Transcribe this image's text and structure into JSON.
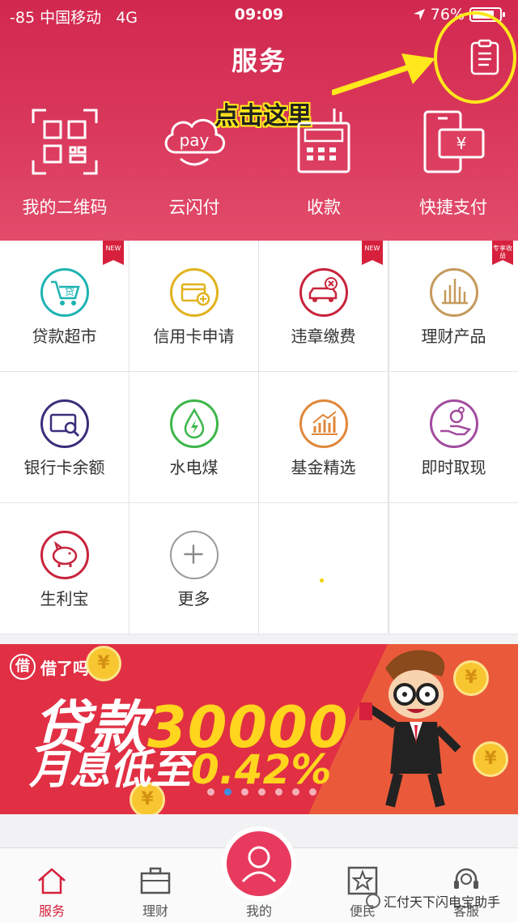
{
  "status_bar": {
    "signal": "-85 中国移动",
    "network": "4G",
    "time": "09:09",
    "battery": "76%"
  },
  "nav": {
    "title": "服务"
  },
  "annotation": {
    "callout": "点击这里",
    "color": "#ffe81c"
  },
  "quick_actions": [
    {
      "label": "我的二维码",
      "icon": "qr-code-icon"
    },
    {
      "label": "云闪付",
      "icon": "cloud-pay-icon",
      "icon_text": "pay"
    },
    {
      "label": "收款",
      "icon": "pos-terminal-icon"
    },
    {
      "label": "快捷支付",
      "icon": "quick-pay-icon",
      "icon_text": "¥"
    }
  ],
  "services": [
    {
      "label": "贷款超市",
      "icon": "loan-cart-icon",
      "icon_text": "贷",
      "color": "#1fb3b3",
      "badge": "NEW"
    },
    {
      "label": "信用卡申请",
      "icon": "credit-card-icon",
      "color": "#e1b21c",
      "badge": ""
    },
    {
      "label": "违章缴费",
      "icon": "car-violation-icon",
      "color": "#c8243c",
      "badge": "NEW"
    },
    {
      "label": "理财产品",
      "icon": "city-building-icon",
      "color": "#c59a5c",
      "badge": "专享收益"
    },
    {
      "label": "银行卡余额",
      "icon": "card-search-icon",
      "color": "#3a2e7a",
      "badge": ""
    },
    {
      "label": "水电煤",
      "icon": "water-drop-icon",
      "color": "#3cb64a",
      "badge": ""
    },
    {
      "label": "基金精选",
      "icon": "fund-chart-icon",
      "color": "#e0873a",
      "badge": ""
    },
    {
      "label": "即时取现",
      "icon": "cash-hand-icon",
      "color": "#a24c9e",
      "badge": ""
    },
    {
      "label": "生利宝",
      "icon": "piggy-bank-icon",
      "color": "#c8243c",
      "badge": ""
    },
    {
      "label": "更多",
      "icon": "plus-icon",
      "color": "#9a9a9a",
      "badge": ""
    }
  ],
  "banner": {
    "brand_logo": "借",
    "brand_name": "借了吗",
    "line1_prefix": "贷款",
    "line1_amount": "30000",
    "line2_prefix": "月息低至",
    "line2_rate": "0.42%",
    "coin_symbol": "¥",
    "pages": 7,
    "active_page": 2
  },
  "tabs": [
    {
      "label": "服务",
      "icon": "home-icon",
      "active": true
    },
    {
      "label": "理财",
      "icon": "briefcase-icon",
      "active": false
    },
    {
      "label": "我的",
      "icon": "user-icon",
      "active": false
    },
    {
      "label": "便民",
      "icon": "star-icon",
      "active": false
    },
    {
      "label": "客服",
      "icon": "headset-icon",
      "active": false
    }
  ],
  "watermark": "汇付天下闪电宝助手",
  "colors": {
    "header": "#d2284f",
    "accent": "#d6203c",
    "banner": "#e12f44"
  }
}
